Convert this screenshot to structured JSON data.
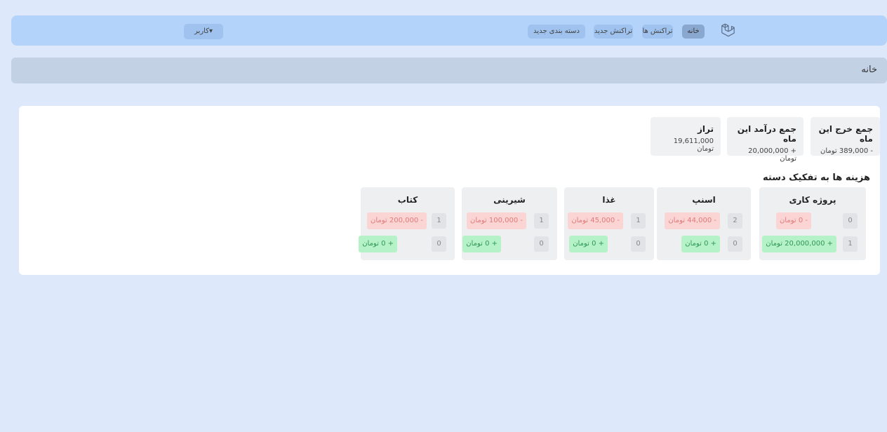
{
  "nav": {
    "home": "خانه",
    "transactions": "تراکنش ها",
    "new_transaction": "تراکنش جدید",
    "new_category": "دسته بندی جدید",
    "user": "کاربر▾"
  },
  "breadcrumb": "خانه",
  "stats": [
    {
      "title": "جمع خرج این ماه",
      "value": "- 389,000 تومان"
    },
    {
      "title": "جمع درآمد این ماه",
      "value": "+ 20,000,000 تومان"
    },
    {
      "title": "تراز",
      "value": "19,611,000 تومان"
    }
  ],
  "section_title": "هزینه ها به تفکیک دسته",
  "categories": [
    {
      "name": "پروژه کاری",
      "expense_count": "0",
      "expense": "- 0 تومان",
      "income_count": "1",
      "income": "+ 20,000,000 تومان"
    },
    {
      "name": "اسنپ",
      "expense_count": "2",
      "expense": "- 44,000 تومان",
      "income_count": "0",
      "income": "+ 0 تومان"
    },
    {
      "name": "غذا",
      "expense_count": "1",
      "expense": "- 45,000 تومان",
      "income_count": "0",
      "income": "+ 0 تومان"
    },
    {
      "name": "شیرینی",
      "expense_count": "1",
      "expense": "- 100,000 تومان",
      "income_count": "0",
      "income": "+ 0 تومان"
    },
    {
      "name": "کتاب",
      "expense_count": "1",
      "expense": "- 200,000 تومان",
      "income_count": "0",
      "income": "+ 0 تومان"
    }
  ],
  "colors": {
    "background": "#dde9fb",
    "navbar": "#b3d3fa",
    "expense_bg": "#fbd4d4",
    "income_bg": "#b6f2c8"
  }
}
